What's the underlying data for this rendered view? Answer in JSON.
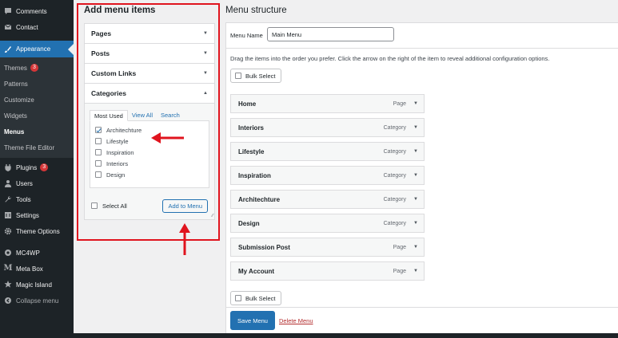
{
  "sidebar": {
    "top_items": [
      {
        "label": "Comments",
        "icon": "comment-icon"
      },
      {
        "label": "Contact",
        "icon": "mail-icon"
      }
    ],
    "active": {
      "label": "Appearance",
      "icon": "paintbrush-icon"
    },
    "submenu": [
      {
        "label": "Themes",
        "badge": "3"
      },
      {
        "label": "Patterns"
      },
      {
        "label": "Customize"
      },
      {
        "label": "Widgets"
      },
      {
        "label": "Menus",
        "current": true
      },
      {
        "label": "Theme File Editor"
      }
    ],
    "bottom_items": [
      {
        "label": "Plugins",
        "icon": "plugin-icon",
        "badge": "3"
      },
      {
        "label": "Users",
        "icon": "users-icon"
      },
      {
        "label": "Tools",
        "icon": "wrench-icon"
      },
      {
        "label": "Settings",
        "icon": "settings-icon"
      },
      {
        "label": "Theme Options",
        "icon": "gear-icon"
      },
      {
        "label": "MC4WP",
        "icon": "mc4wp-icon"
      },
      {
        "label": "Meta Box",
        "icon": "metabox-icon"
      },
      {
        "label": "Magic Island",
        "icon": "island-icon"
      },
      {
        "label": "Collapse menu",
        "icon": "collapse-icon"
      }
    ]
  },
  "add_items": {
    "title": "Add menu items",
    "sections": [
      "Pages",
      "Posts",
      "Custom Links",
      "Categories"
    ],
    "tabs": [
      "Most Used",
      "View All",
      "Search"
    ],
    "categories": [
      {
        "label": "Architechture",
        "checked": true
      },
      {
        "label": "Lifestyle",
        "checked": false
      },
      {
        "label": "Inspiration",
        "checked": false
      },
      {
        "label": "Interiors",
        "checked": false
      },
      {
        "label": "Design",
        "checked": false
      }
    ],
    "select_all": "Select All",
    "add_button": "Add to Menu"
  },
  "structure": {
    "title": "Menu structure",
    "menu_name_label": "Menu Name",
    "menu_name_value": "Main Menu",
    "instructions": "Drag the items into the order you prefer. Click the arrow on the right of the item to reveal additional configuration options.",
    "bulk_select": "Bulk Select",
    "items": [
      {
        "label": "Home",
        "type": "Page"
      },
      {
        "label": "Interiors",
        "type": "Category"
      },
      {
        "label": "Lifestyle",
        "type": "Category"
      },
      {
        "label": "Inspiration",
        "type": "Category"
      },
      {
        "label": "Architechture",
        "type": "Category"
      },
      {
        "label": "Design",
        "type": "Category"
      },
      {
        "label": "Submission Post",
        "type": "Page"
      },
      {
        "label": "My Account",
        "type": "Page"
      }
    ],
    "save_button": "Save Menu",
    "delete_link": "Delete Menu"
  },
  "colors": {
    "sidebar_bg": "#1d2327",
    "accent": "#2271b1",
    "annotation_red": "#e0141e",
    "badge_red": "#d63638"
  }
}
